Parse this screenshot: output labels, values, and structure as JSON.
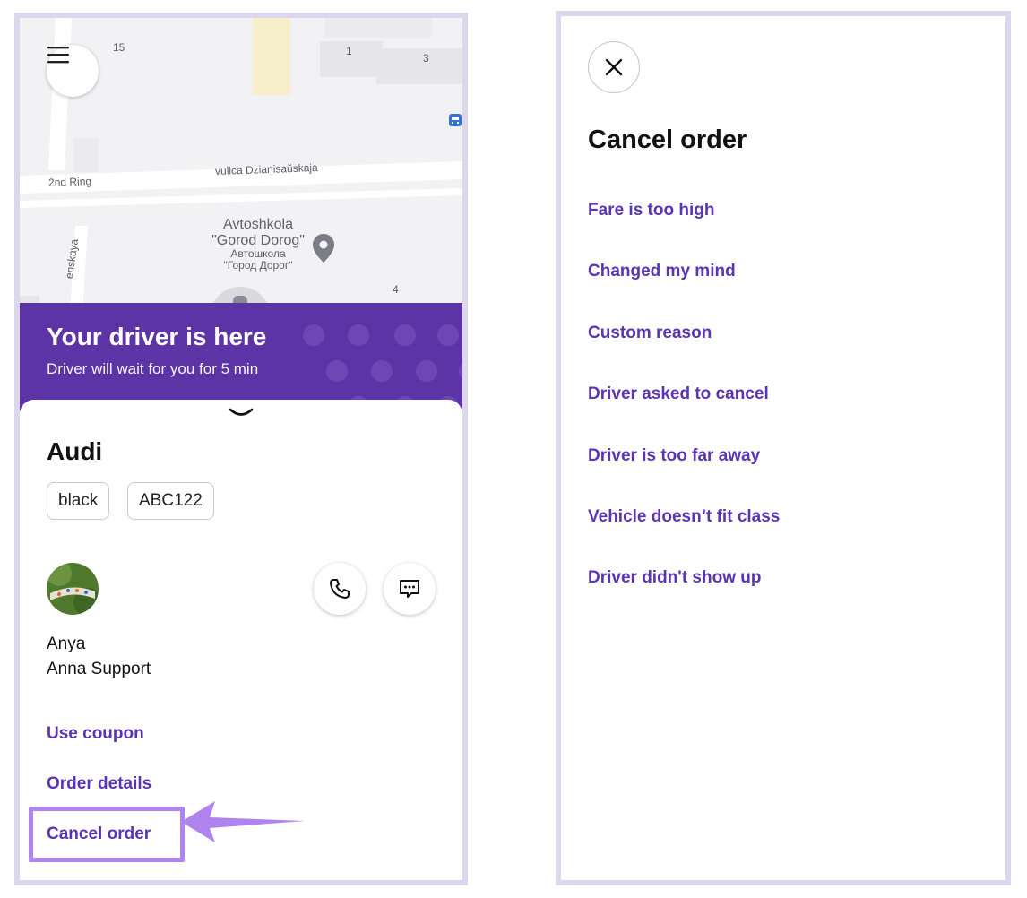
{
  "map": {
    "labels": {
      "num15": "15",
      "num1": "1",
      "num3": "3",
      "num4": "4",
      "ring": "2nd Ring",
      "street": "vulica Dzianisaŭskaja",
      "side_street": "enskaya",
      "poi_line1": "Avtoshkola",
      "poi_line2": "\"Gorod Dorog\"",
      "poi_line3": "Автошкола",
      "poi_line4": "\"Город Дорог\""
    }
  },
  "banner": {
    "title": "Your driver is here",
    "subtitle": "Driver will wait for you for 5 min"
  },
  "car": {
    "model": "Audi",
    "color": "black",
    "plate": "ABC122"
  },
  "driver": {
    "name": "Anya",
    "company": "Anna Support"
  },
  "actions": {
    "use_coupon": "Use coupon",
    "order_details": "Order details",
    "cancel_order": "Cancel order"
  },
  "cancel_panel": {
    "title": "Cancel order",
    "reasons": [
      "Fare is too high",
      "Changed my mind",
      "Custom reason",
      "Driver asked to cancel",
      "Driver is too far away",
      "Vehicle doesn’t fit class",
      "Driver didn't show up"
    ]
  },
  "colors": {
    "accent": "#5b34b5",
    "banner": "#5c34a6",
    "highlight": "#b084ef",
    "frame": "#dcd7ec"
  },
  "icons": {
    "menu": "menu-icon",
    "close": "close-icon",
    "phone": "phone-icon",
    "chat": "chat-icon",
    "chevron": "chevron-down-icon",
    "pin": "map-pin-icon",
    "bus": "bus-stop-icon"
  }
}
